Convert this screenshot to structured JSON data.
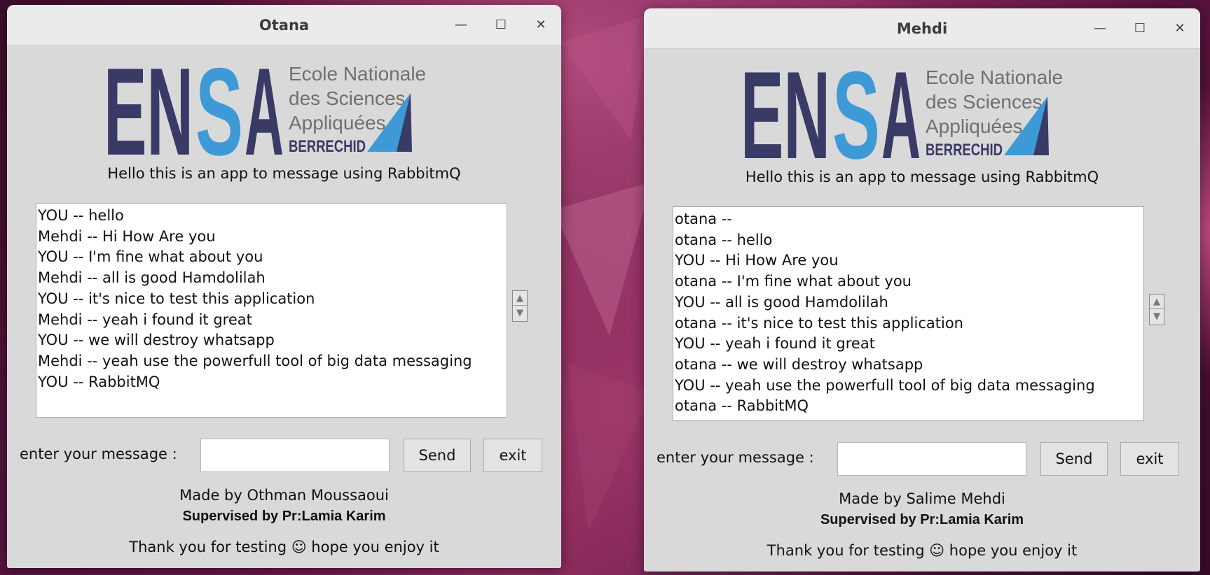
{
  "windows": [
    {
      "title": "Otana",
      "logo": {
        "letters": [
          "EN",
          "S",
          "A"
        ],
        "line1": "Ecole Nationale",
        "line2": "des Sciences",
        "line3": "Appliquées",
        "city": "BERRECHID"
      },
      "subtitle": "Hello this is an app to message using RabbitmQ",
      "messages": [
        "YOU -- hello",
        "Mehdi -- Hi How Are you",
        "YOU -- I'm fine what about you",
        "Mehdi -- all is good Hamdolilah",
        "YOU -- it's nice to test this application",
        "Mehdi -- yeah i found it great",
        "YOU -- we will destroy whatsapp",
        "Mehdi -- yeah use the powerfull tool of big data messaging",
        "YOU -- RabbitMQ"
      ],
      "input_label": "enter your message :",
      "input_value": "",
      "send_label": "Send",
      "exit_label": "exit",
      "made_by": "Made by Othman Moussaoui",
      "supervised": "Supervised by Pr:Lamia Karim",
      "thanks": "Thank you for testing ☺ hope you enjoy it"
    },
    {
      "title": "Mehdi",
      "logo": {
        "letters": [
          "EN",
          "S",
          "A"
        ],
        "line1": "Ecole Nationale",
        "line2": "des Sciences",
        "line3": "Appliquées",
        "city": "BERRECHID"
      },
      "subtitle": "Hello this is an app to message using RabbitmQ",
      "messages": [
        "otana --",
        "otana -- hello",
        "YOU -- Hi How Are you",
        "otana -- I'm fine what about you",
        "YOU -- all is good Hamdolilah",
        "otana -- it's nice to test this application",
        "YOU -- yeah i found it great",
        "otana -- we will destroy whatsapp",
        "YOU -- yeah use the powerfull tool of big data messaging",
        "otana -- RabbitMQ"
      ],
      "input_label": "enter your message :",
      "input_value": "",
      "send_label": "Send",
      "exit_label": "exit",
      "made_by": "Made by Salime Mehdi",
      "supervised": "Supervised by Pr:Lamia Karim",
      "thanks": "Thank you for testing ☺ hope you enjoy it"
    }
  ],
  "window_controls": {
    "minimize_glyph": "—",
    "maximize_glyph": "☐",
    "close_glyph": "✕"
  },
  "colors": {
    "ensa_dark": "#3a3a66",
    "ensa_blue": "#3d9ad6",
    "window_bg": "#d9d9d9",
    "titlebar_bg": "#ebebeb"
  }
}
